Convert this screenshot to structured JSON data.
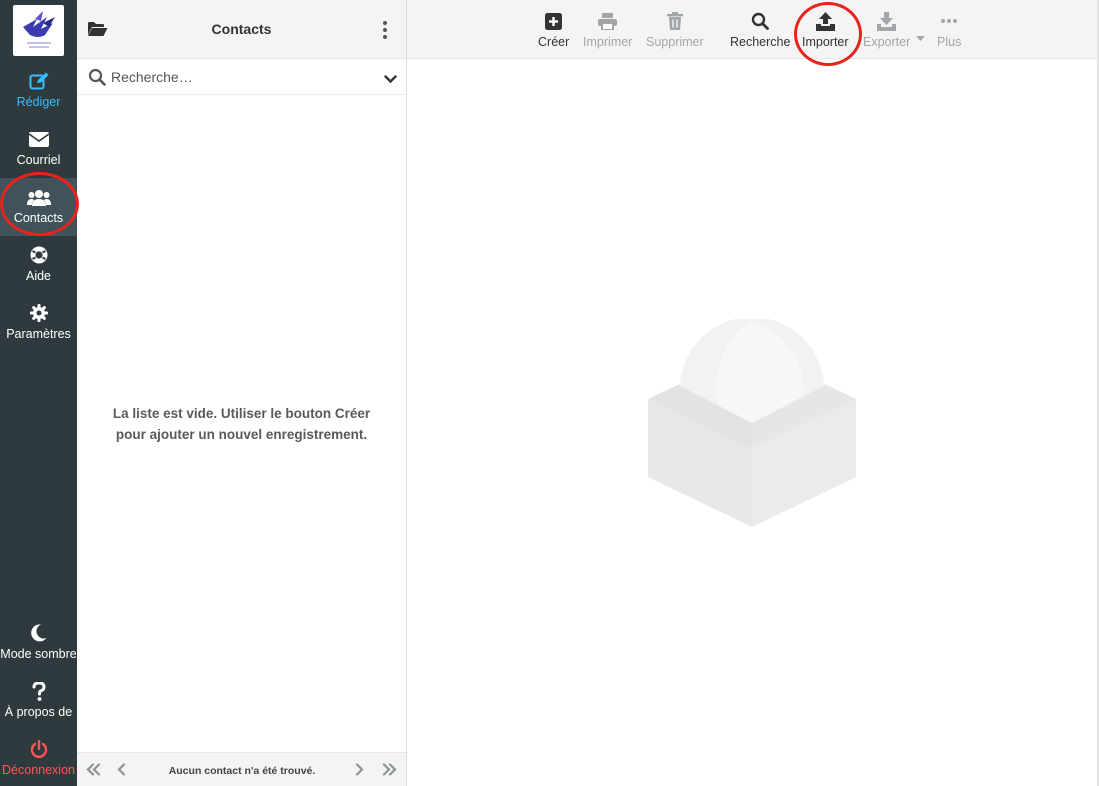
{
  "nav": {
    "logo_icon": "bird-logo-icon",
    "items": [
      {
        "id": "compose",
        "label": "Rédiger",
        "icon": "pencil-square-icon"
      },
      {
        "id": "mail",
        "label": "Courriel",
        "icon": "envelope-icon"
      },
      {
        "id": "contacts",
        "label": "Contacts",
        "icon": "users-icon"
      },
      {
        "id": "help",
        "label": "Aide",
        "icon": "lifebuoy-icon"
      },
      {
        "id": "settings",
        "label": "Paramètres",
        "icon": "gear-icon"
      },
      {
        "id": "darkmode",
        "label": "Mode sombre",
        "icon": "moon-icon"
      },
      {
        "id": "about",
        "label": "À propos de",
        "icon": "question-icon"
      },
      {
        "id": "logout",
        "label": "Déconnexion",
        "icon": "power-icon"
      }
    ]
  },
  "list": {
    "title": "Contacts",
    "search_placeholder": "Recherche…",
    "empty_message": "La liste est vide. Utiliser le bouton Créer pour ajouter un nouvel enregistrement.",
    "footer_status": "Aucun contact n'a été trouvé."
  },
  "toolbar": {
    "create": "Créer",
    "print": "Imprimer",
    "delete": "Supprimer",
    "search": "Recherche",
    "import": "Importer",
    "export": "Exporter",
    "more": "Plus"
  },
  "colors": {
    "nav_bg": "#2f3a3f",
    "accent": "#37beff",
    "logout": "#ff5552",
    "highlight_circle": "#e8231c"
  }
}
